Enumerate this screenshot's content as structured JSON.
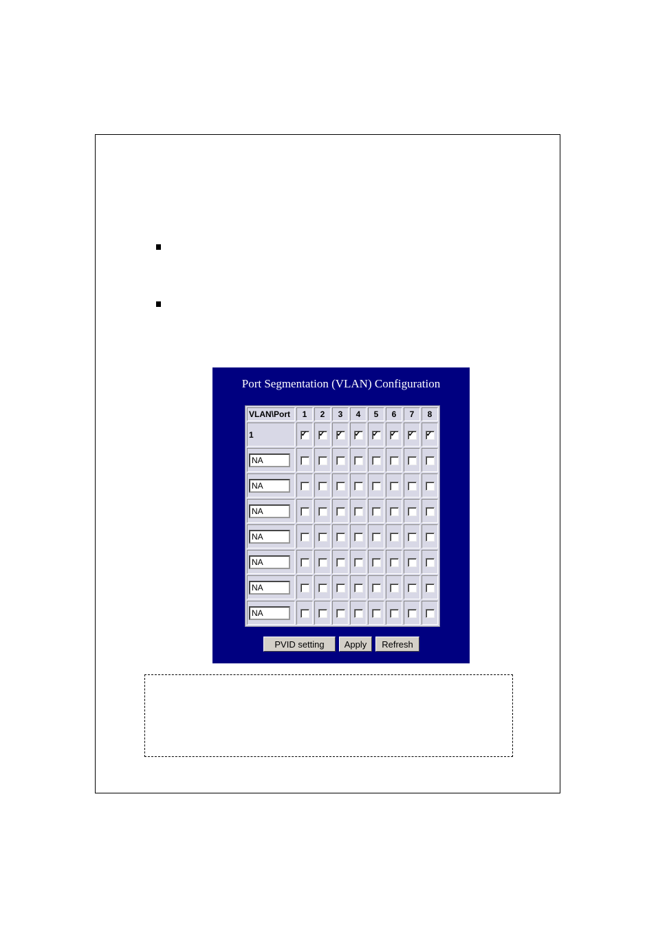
{
  "panel": {
    "title": "Port Segmentation (VLAN) Configuration",
    "colors": {
      "background": "#000080",
      "table": "#d8d8e6",
      "title_text": "#ffffff"
    }
  },
  "table": {
    "header_first": "VLAN\\Port",
    "ports": [
      "1",
      "2",
      "3",
      "4",
      "5",
      "6",
      "7",
      "8"
    ],
    "rows": [
      {
        "vlan": "1",
        "editable": false,
        "members": [
          true,
          true,
          true,
          true,
          true,
          true,
          true,
          true
        ]
      },
      {
        "vlan": "NA",
        "editable": true,
        "members": [
          false,
          false,
          false,
          false,
          false,
          false,
          false,
          false
        ]
      },
      {
        "vlan": "NA",
        "editable": true,
        "members": [
          false,
          false,
          false,
          false,
          false,
          false,
          false,
          false
        ]
      },
      {
        "vlan": "NA",
        "editable": true,
        "members": [
          false,
          false,
          false,
          false,
          false,
          false,
          false,
          false
        ]
      },
      {
        "vlan": "NA",
        "editable": true,
        "members": [
          false,
          false,
          false,
          false,
          false,
          false,
          false,
          false
        ]
      },
      {
        "vlan": "NA",
        "editable": true,
        "members": [
          false,
          false,
          false,
          false,
          false,
          false,
          false,
          false
        ]
      },
      {
        "vlan": "NA",
        "editable": true,
        "members": [
          false,
          false,
          false,
          false,
          false,
          false,
          false,
          false
        ]
      },
      {
        "vlan": "NA",
        "editable": true,
        "members": [
          false,
          false,
          false,
          false,
          false,
          false,
          false,
          false
        ]
      }
    ]
  },
  "buttons": {
    "pvid_label": "PVID setting",
    "apply_label": "Apply",
    "refresh_label": "Refresh"
  },
  "bullets": [
    {
      "icon": "square-bullet-icon"
    },
    {
      "icon": "square-bullet-icon"
    }
  ]
}
